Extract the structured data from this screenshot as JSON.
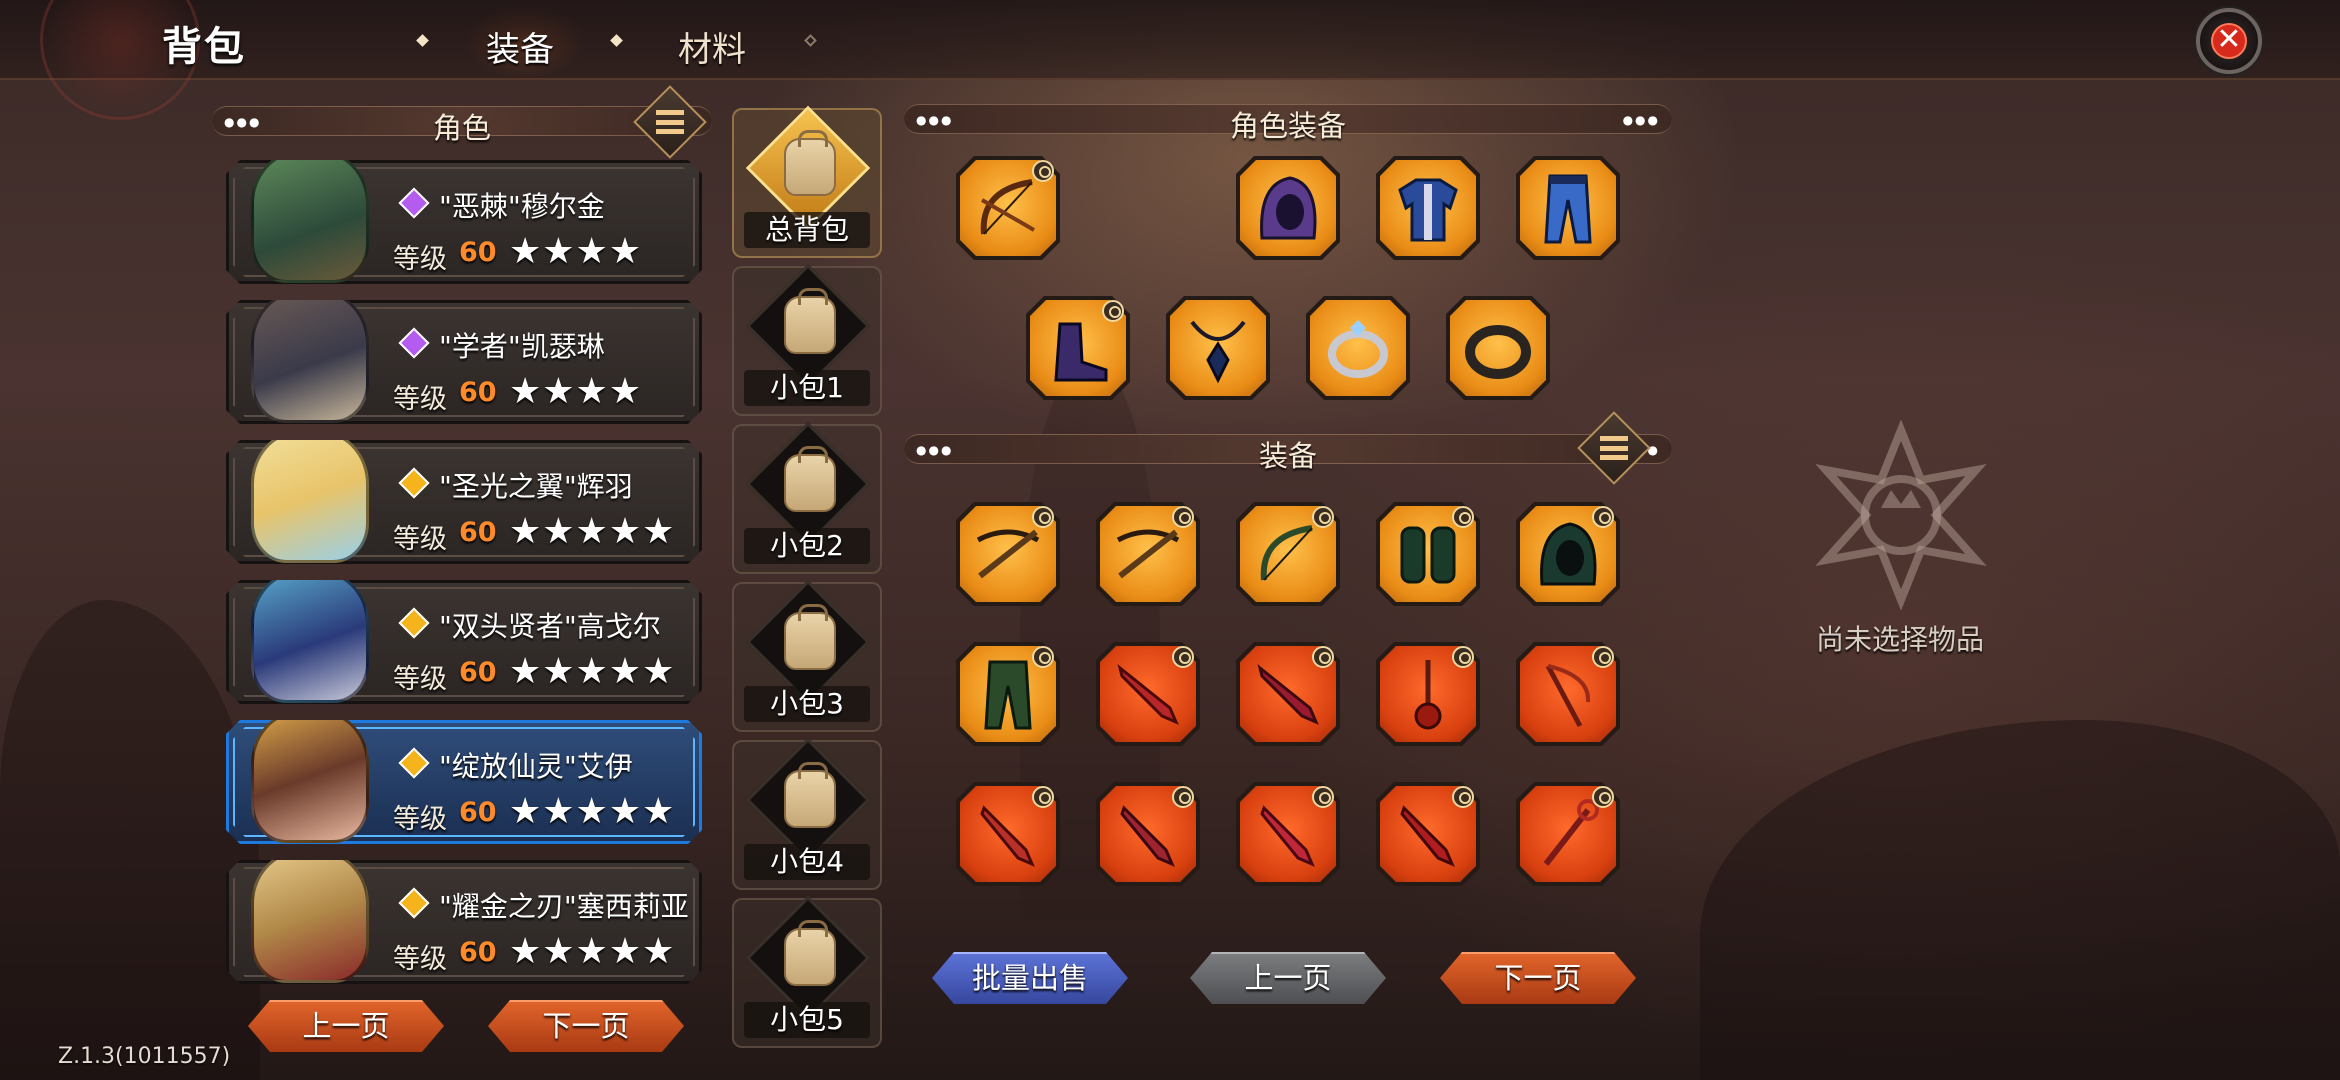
{
  "header": {
    "title": "背包",
    "tabs": [
      {
        "label": "装备",
        "active": true
      },
      {
        "label": "材料",
        "active": false
      }
    ]
  },
  "characters_panel": {
    "title": "角色",
    "level_label": "等级",
    "characters": [
      {
        "name": "\"恶棘\"穆尔金",
        "rarity": "purple",
        "level": "60",
        "stars": "★★★★"
      },
      {
        "name": "\"学者\"凯瑟琳",
        "rarity": "purple",
        "level": "60",
        "stars": "★★★★"
      },
      {
        "name": "\"圣光之翼\"辉羽",
        "rarity": "gold",
        "level": "60",
        "stars": "★★★★★"
      },
      {
        "name": "\"双头贤者\"高戈尔",
        "rarity": "gold",
        "level": "60",
        "stars": "★★★★★"
      },
      {
        "name": "\"绽放仙灵\"艾伊",
        "rarity": "gold",
        "level": "60",
        "stars": "★★★★★",
        "selected": true
      },
      {
        "name": "\"耀金之刃\"塞西莉亚",
        "rarity": "gold",
        "level": "60",
        "stars": "★★★★★"
      }
    ],
    "prev_label": "上一页",
    "next_label": "下一页"
  },
  "bags": [
    {
      "label": "总背包"
    },
    {
      "label": "小包1"
    },
    {
      "label": "小包2"
    },
    {
      "label": "小包3"
    },
    {
      "label": "小包4"
    },
    {
      "label": "小包5"
    }
  ],
  "character_equipment": {
    "title": "角色装备",
    "row1": [
      "bow-icon",
      "hood-icon",
      "armor-icon",
      "pants-icon"
    ],
    "row2": [
      "boots-icon",
      "necklace-icon",
      "ring-icon",
      "ring-dark-icon"
    ]
  },
  "equipment": {
    "title": "装备",
    "rows": [
      [
        "crossbow-icon",
        "crossbow-icon",
        "bow-icon",
        "gloves-icon",
        "hood-icon"
      ],
      [
        "pants-icon",
        "sword-icon",
        "sword-icon",
        "flail-icon",
        "whip-icon"
      ],
      [
        "dagger-icon",
        "dagger-icon",
        "dagger-icon",
        "dagger-icon",
        "staff-icon"
      ]
    ],
    "batch_sell_label": "批量出售",
    "prev_label": "上一页",
    "next_label": "下一页"
  },
  "detail": {
    "empty_text": "尚未选择物品"
  },
  "version": "Z.1.3(1011557)",
  "colors": {
    "rarity_purple": "#b55cf0",
    "rarity_gold": "#f5b31c",
    "slot_orange": "#e98c16",
    "slot_red": "#d8400f",
    "level_value": "#ff8a2a",
    "selected_border": "#1f7ae0"
  }
}
